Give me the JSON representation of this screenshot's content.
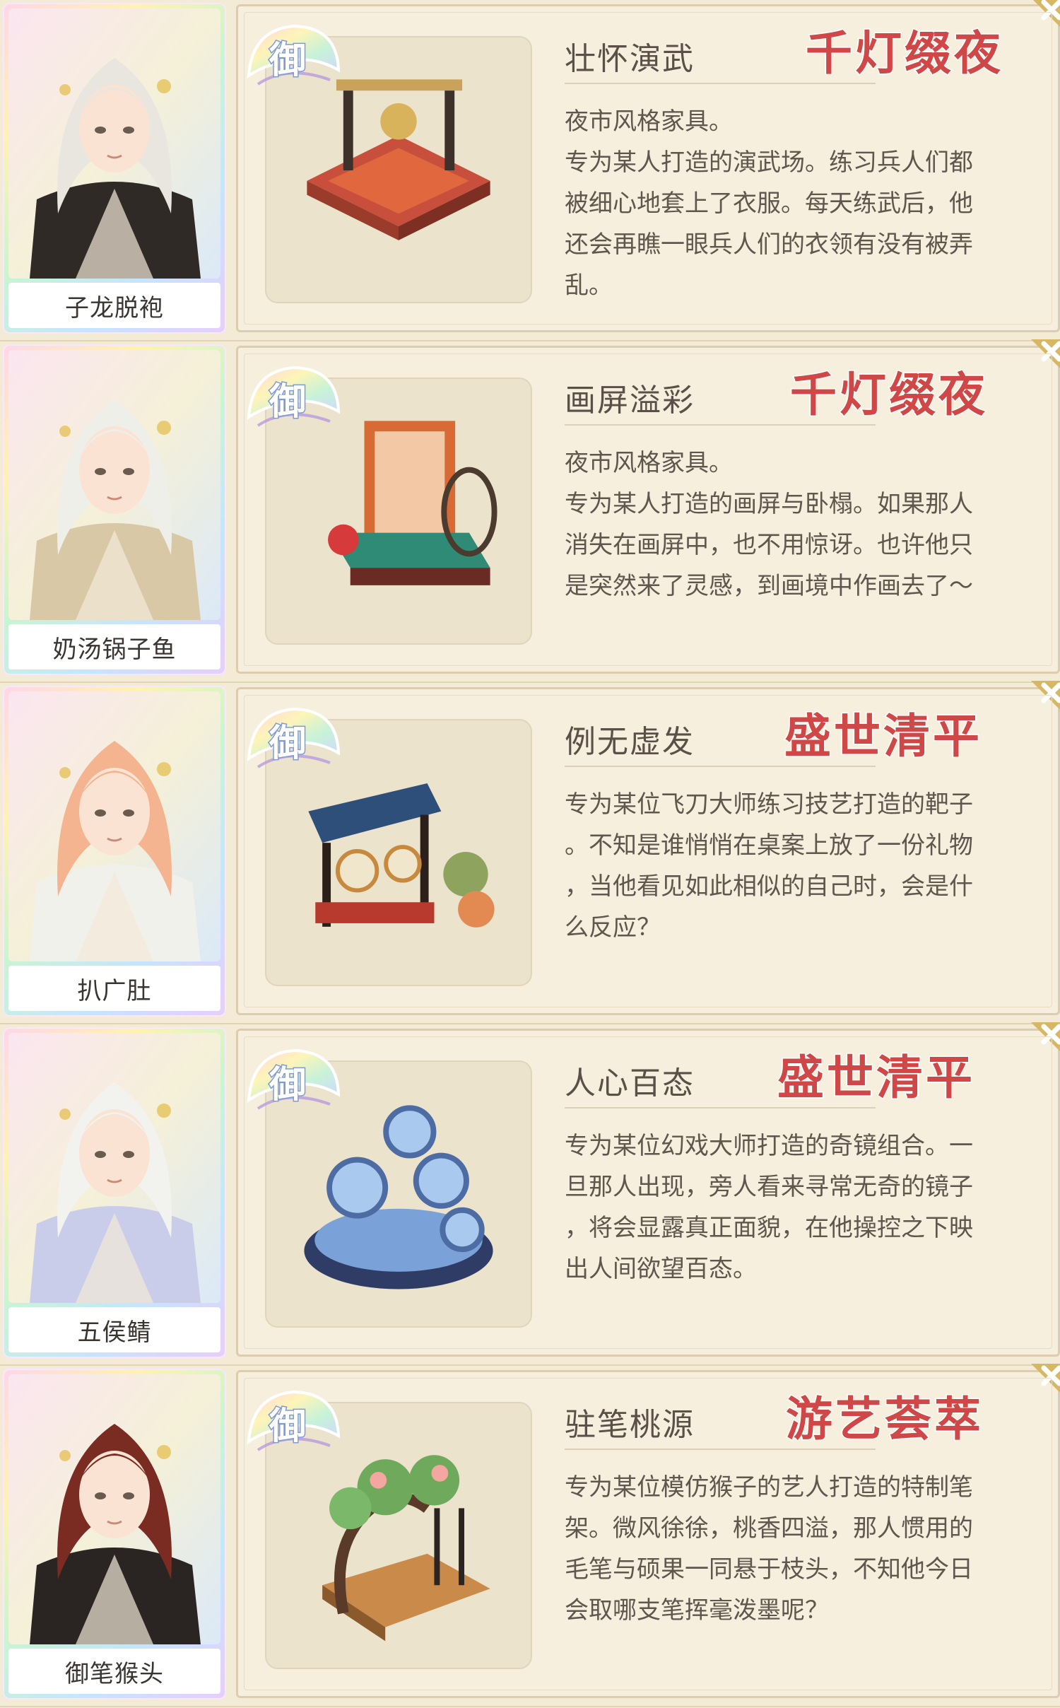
{
  "rows": [
    {
      "character_name": "子龙脱袍",
      "item_name": "壮怀演武",
      "series_tag": "千灯缀夜",
      "desc_lines": [
        "夜市风格家具。",
        "专为某人打造的演武场。练习兵人们都",
        "被细心地套上了衣服。每天练武后，他",
        "还会再瞧一眼兵人们的衣领有没有被弄",
        "乱。"
      ],
      "hair_color": "#e9e6df",
      "outfit_color": "#2f2a26"
    },
    {
      "character_name": "奶汤锅子鱼",
      "item_name": "画屏溢彩",
      "series_tag": "千灯缀夜",
      "desc_lines": [
        "夜市风格家具。",
        "专为某人打造的画屏与卧榻。如果那人",
        "消失在画屏中，也不用惊讶。也许他只",
        "是突然来了灵感，到画境中作画去了～"
      ],
      "hair_color": "#efefe9",
      "outfit_color": "#d8c8a6"
    },
    {
      "character_name": "扒广肚",
      "item_name": "例无虚发",
      "series_tag": "盛世清平",
      "desc_lines": [
        "专为某位飞刀大师练习技艺打造的靶子",
        "。不知是谁悄悄在桌案上放了一份礼物",
        "，当他看见如此相似的自己时，会是什",
        "么反应？"
      ],
      "hair_color": "#f3b48f",
      "outfit_color": "#f1f1ec"
    },
    {
      "character_name": "五侯鲭",
      "item_name": "人心百态",
      "series_tag": "盛世清平",
      "desc_lines": [
        "专为某位幻戏大师打造的奇镜组合。一",
        "旦那人出现，旁人看来寻常无奇的镜子",
        "，将会显露真正面貌，在他操控之下映",
        "出人间欲望百态。"
      ],
      "hair_color": "#f2f2ef",
      "outfit_color": "#c9cde9"
    },
    {
      "character_name": "御笔猴头",
      "item_name": "驻笔桃源",
      "series_tag": "游艺荟萃",
      "desc_lines": [
        "专为某位模仿猴子的艺人打造的特制笔",
        "架。微风徐徐，桃香四溢，那人惯用的",
        "毛笔与硕果一同悬于枝头，不知他今日",
        "会取哪支笔挥毫泼墨呢？"
      ],
      "hair_color": "#7a2b22",
      "outfit_color": "#2a2422"
    }
  ],
  "badge_text": "御",
  "colors": {
    "series_tag": "#d04747",
    "panel_bg": "#f6efdd",
    "page_bg": "#f3ebd6"
  },
  "icons": {
    "badge": "yu-fan-badge-icon",
    "close": "close-x-icon"
  }
}
